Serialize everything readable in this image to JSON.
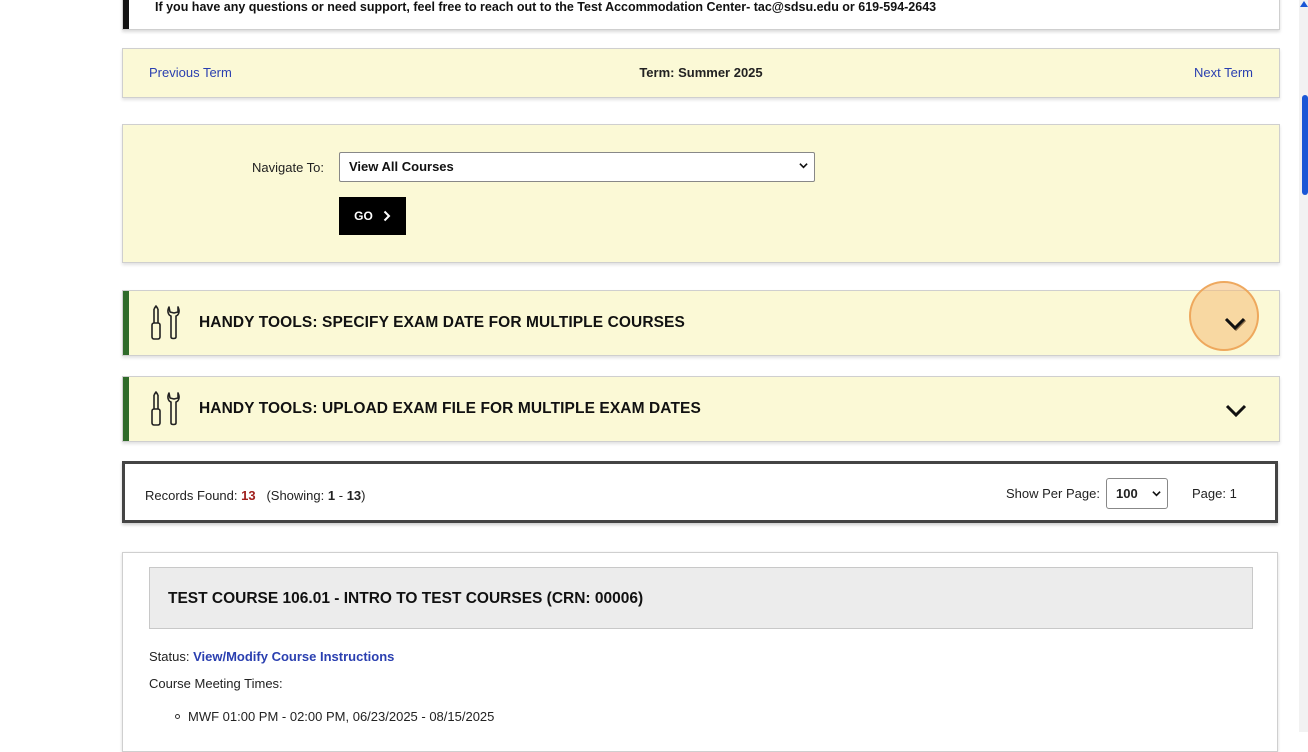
{
  "notice": {
    "text": "If you have any questions or need support, feel free to reach out to the Test Accommodation Center- tac@sdsu.edu or 619-594-2643"
  },
  "term_bar": {
    "previous": "Previous Term",
    "current": "Term: Summer 2025",
    "next": "Next Term"
  },
  "navigate": {
    "label": "Navigate To:",
    "selected": "View All Courses",
    "go_label": "GO"
  },
  "tools": [
    {
      "title": "HANDY TOOLS: SPECIFY EXAM DATE FOR MULTIPLE COURSES",
      "icon": "tools-icon",
      "toggle_icon": "chevron-down-icon"
    },
    {
      "title": "HANDY TOOLS: UPLOAD EXAM FILE FOR MULTIPLE EXAM DATES",
      "icon": "tools-icon",
      "toggle_icon": "chevron-down-icon"
    }
  ],
  "records": {
    "found_label": "Records Found:",
    "found_count": "13",
    "showing_label": "(Showing:",
    "showing_from": "1",
    "showing_sep": "-",
    "showing_to": "13",
    "showing_close": ")",
    "per_page_label": "Show Per Page:",
    "per_page_value": "100",
    "page_label": "Page: 1"
  },
  "course": {
    "title": "TEST COURSE 106.01 - INTRO TO TEST COURSES (CRN: 00006)",
    "status_label": "Status:",
    "status_link": "View/Modify Course Instructions",
    "meeting_label": "Course Meeting Times:",
    "meetings": [
      "MWF 01:00 PM - 02:00 PM, 06/23/2025 - 08/15/2025"
    ]
  },
  "colors": {
    "panel_bg": "#fbf9d6",
    "accent_green": "#2f6b2a",
    "link_blue": "#2a3fb0",
    "count_red": "#a0201e",
    "highlight": "#f6be78"
  }
}
